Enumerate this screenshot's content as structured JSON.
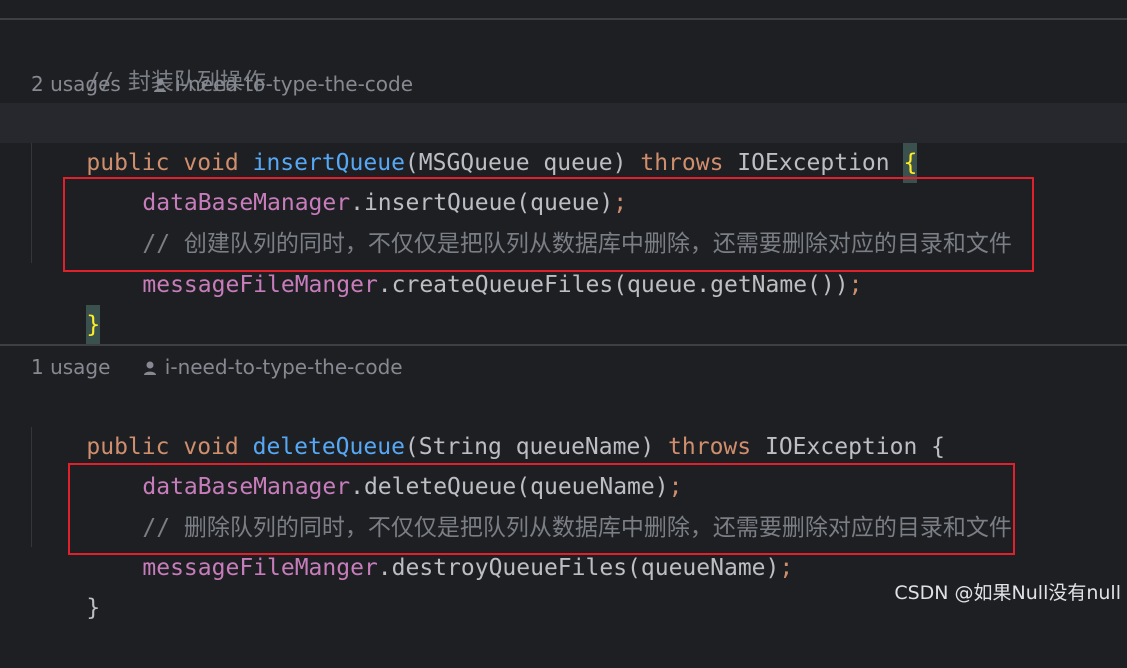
{
  "block1": {
    "comment": "// 封装队列操作",
    "usages": "2 usages",
    "author": "i-need-to-type-the-code",
    "sig": {
      "kw_public": "public",
      "kw_void": "void",
      "method": "insertQueue",
      "params": "(MSGQueue queue)",
      "kw_throws": "throws",
      "exception": "IOException",
      "open_brace": "{"
    },
    "line1": {
      "field": "dataBaseManager",
      "call": ".insertQueue(queue)",
      "semi": ";"
    },
    "line2_comment": "// 创建队列的同时，不仅仅是把队列从数据库中删除，还需要删除对应的目录和文件",
    "line3": {
      "field": "messageFileManger",
      "call": ".createQueueFiles(queue.getName())",
      "semi": ";"
    },
    "close_brace": "}"
  },
  "block2": {
    "usages": "1 usage",
    "author": "i-need-to-type-the-code",
    "sig": {
      "kw_public": "public",
      "kw_void": "void",
      "method": "deleteQueue",
      "params": "(String queueName)",
      "kw_throws": "throws",
      "exception": "IOException",
      "open_brace": "{"
    },
    "line1": {
      "field": "dataBaseManager",
      "call": ".deleteQueue(queueName)",
      "semi": ";"
    },
    "line2_comment": "// 删除队列的同时，不仅仅是把队列从数据库中删除，还需要删除对应的目录和文件",
    "line3": {
      "field": "messageFileManger",
      "call": ".destroyQueueFiles(queueName)",
      "semi": ";"
    },
    "close_brace": "}"
  },
  "watermark": "CSDN @如果Null没有null",
  "colors": {
    "background": "#1e1f22",
    "keyword": "#cf8e6d",
    "method": "#56a8f5",
    "field": "#c77dbb",
    "comment": "#7a7e85",
    "highlight_box": "#e0202a"
  },
  "icons": {
    "author": "user-icon"
  }
}
